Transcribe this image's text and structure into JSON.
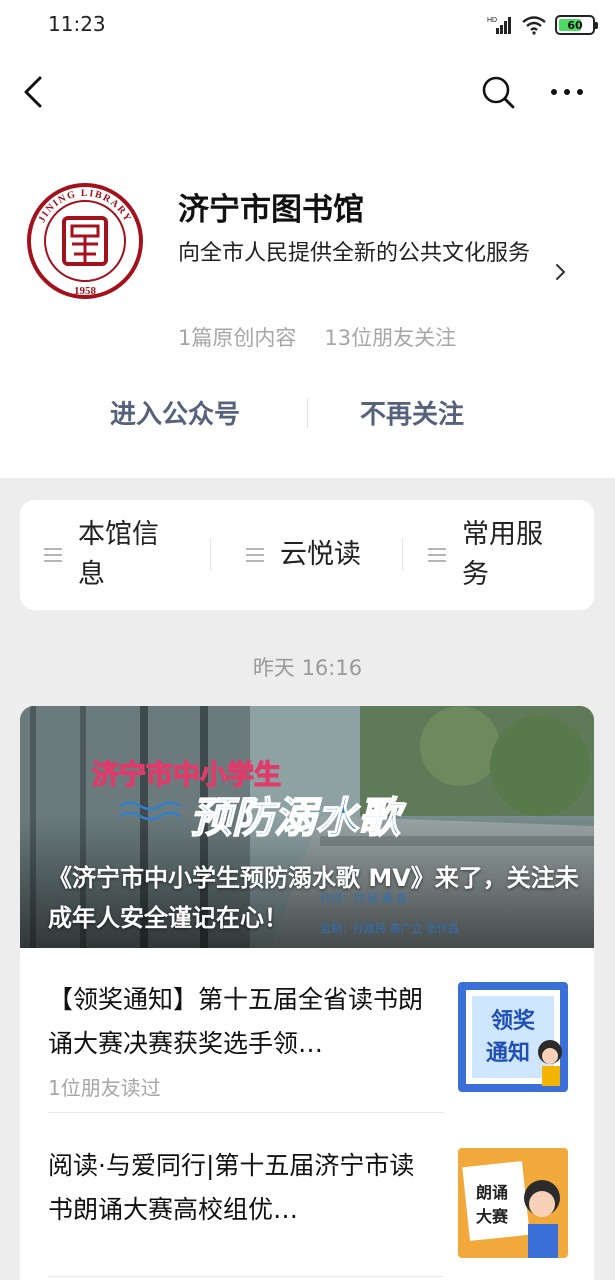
{
  "status_bar": {
    "time": "11:23",
    "battery": "60"
  },
  "account": {
    "name": "济宁市图书馆",
    "description": "向全市人民提供全新的公共文化服务",
    "original_count": "1篇原创内容",
    "friends_following": "13位朋友关注",
    "logo_text_top": "JINING LIBRARY",
    "logo_year": "1958"
  },
  "actions": {
    "enter": "进入公众号",
    "unfollow": "不再关注"
  },
  "menu": [
    {
      "label": "本馆信息"
    },
    {
      "label": "云悦读"
    },
    {
      "label": "常用服务"
    }
  ],
  "feed": {
    "date": "昨天 16:16",
    "cover": {
      "headline": "《济宁市中小学生预防溺水歌 MV》来了，关注未成年人安全谨记在心！",
      "banner_line1": "济宁市中小学生",
      "banner_line2": "预防溺水歌",
      "credits_line1": "作词：刘 丽 蕉 勇",
      "credits_line2": "监制：孙建民 高广立 张作昌"
    },
    "articles": [
      {
        "title": "【领奖通知】第十五届全省读书朗诵大赛决赛获奖选手领…",
        "meta": "1位朋友读过",
        "thumb_text": [
          "领奖",
          "通知"
        ]
      },
      {
        "title": "阅读·与爱同行|第十五届济宁市读书朗诵大赛高校组优…",
        "meta": "",
        "thumb_text": [
          "朗诵",
          "大赛"
        ]
      }
    ]
  }
}
